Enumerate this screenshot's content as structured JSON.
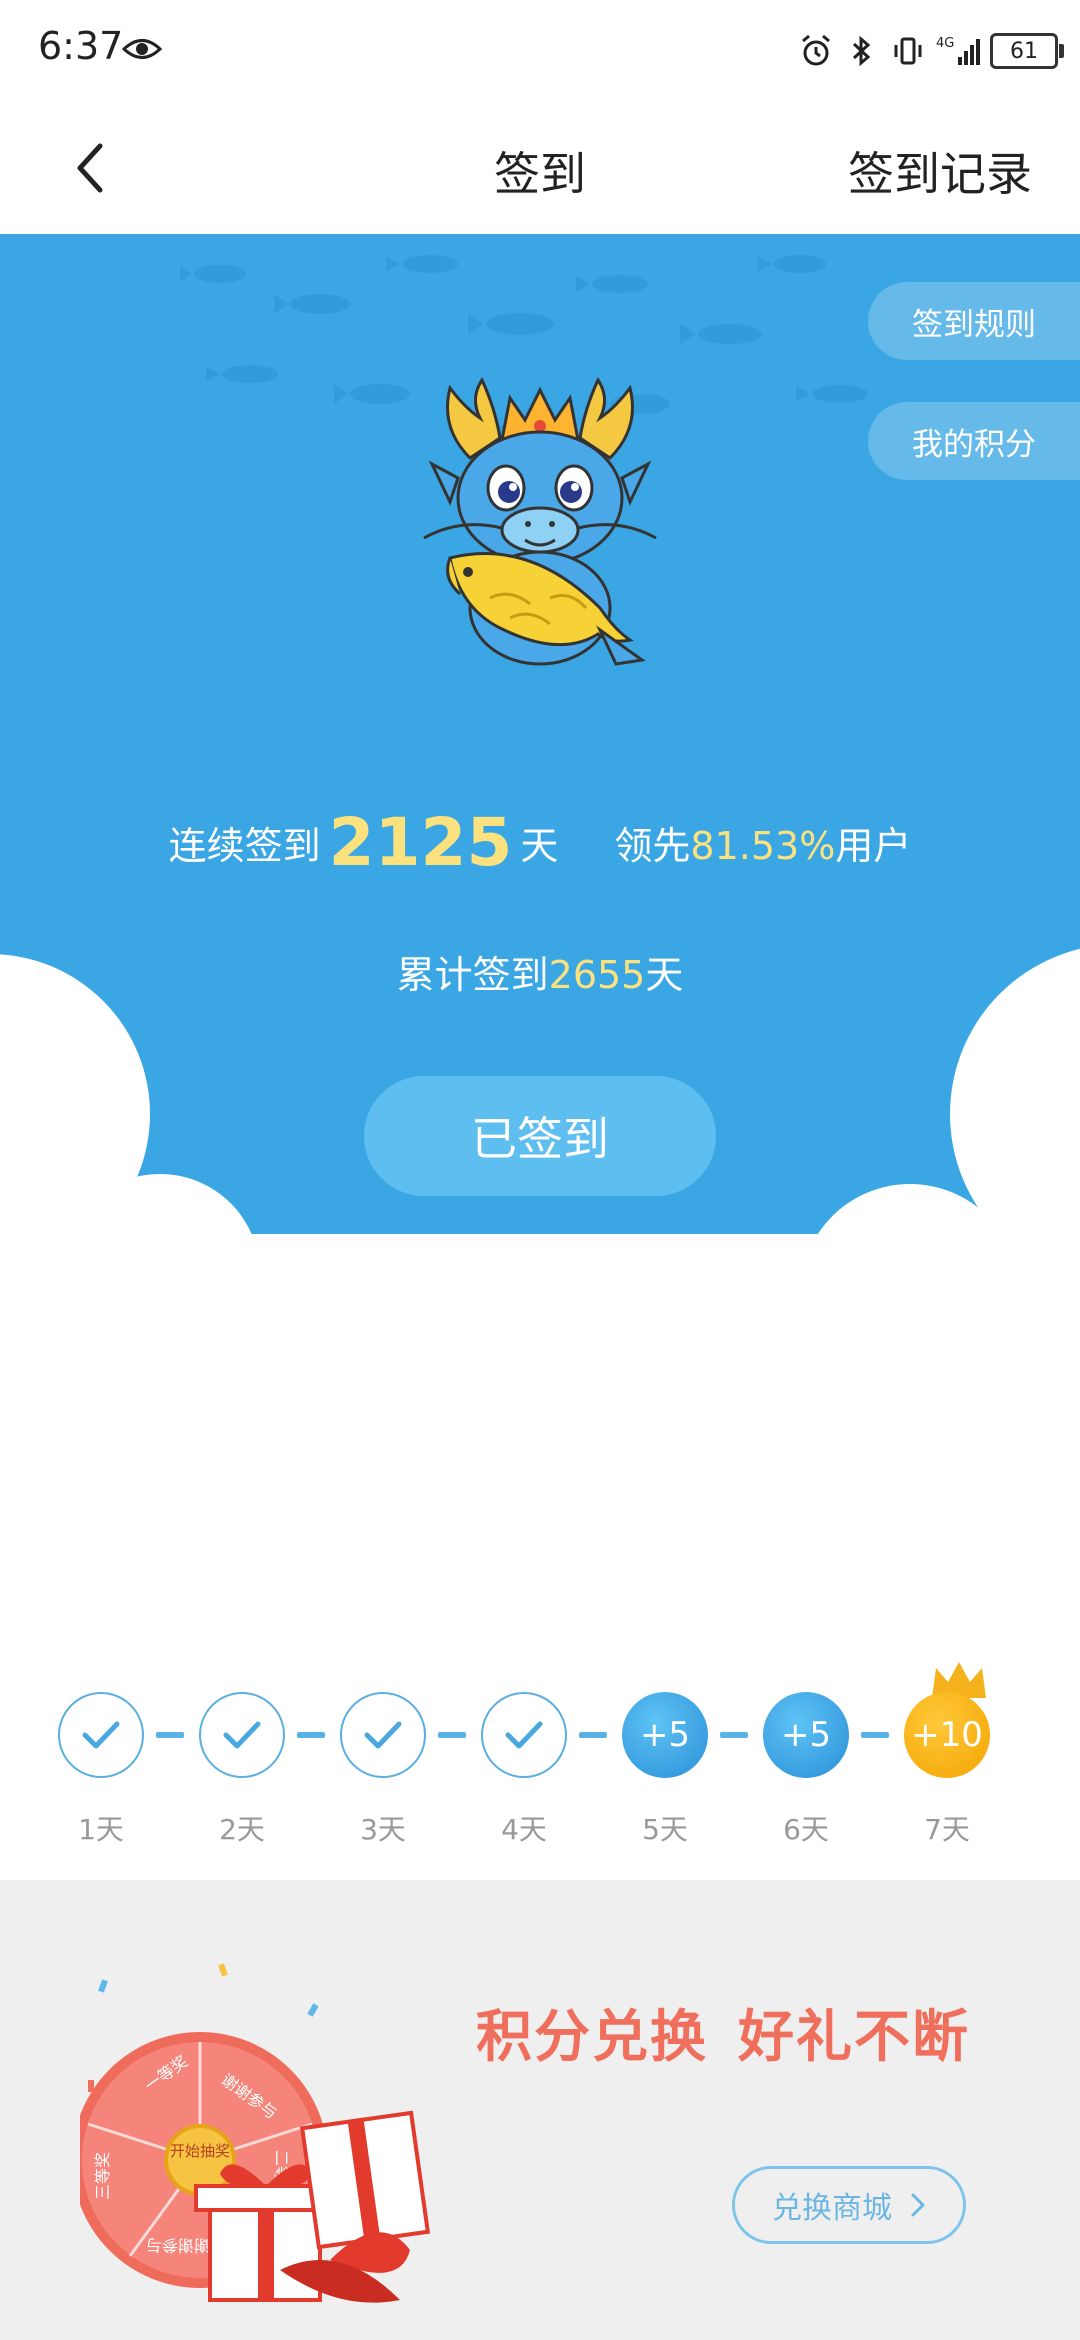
{
  "status_bar": {
    "time": "6:37",
    "battery": "61",
    "network": "4G"
  },
  "nav": {
    "title": "签到",
    "record_label": "签到记录"
  },
  "hero": {
    "rules_label": "签到规则",
    "points_label": "我的积分",
    "streak_prefix": "连续签到",
    "streak_days": "2125",
    "streak_unit": "天",
    "lead_prefix": "领先",
    "lead_percent": "81.53%",
    "lead_suffix": "用户",
    "total_prefix": "累计签到",
    "total_days": "2655",
    "total_unit": "天",
    "signed_button_label": "已签到",
    "colors": {
      "background": "#3aa7e4",
      "highlight": "#fbe27e"
    }
  },
  "progress": {
    "days": [
      {
        "label": "1天",
        "state": "done",
        "reward": ""
      },
      {
        "label": "2天",
        "state": "done",
        "reward": ""
      },
      {
        "label": "3天",
        "state": "done",
        "reward": ""
      },
      {
        "label": "4天",
        "state": "done",
        "reward": ""
      },
      {
        "label": "5天",
        "state": "future",
        "reward": "+5"
      },
      {
        "label": "6天",
        "state": "future",
        "reward": "+5"
      },
      {
        "label": "7天",
        "state": "bonus",
        "reward": "+10"
      }
    ]
  },
  "banner": {
    "title_part1": "积分兑换",
    "title_part2": "好礼不断",
    "exchange_button_label": "兑换商城",
    "wheel_center_label": "开始抽奖",
    "wheel_segments": [
      "一等奖",
      "谢谢参与",
      "二等奖",
      "三等奖",
      "谢谢参与"
    ]
  }
}
